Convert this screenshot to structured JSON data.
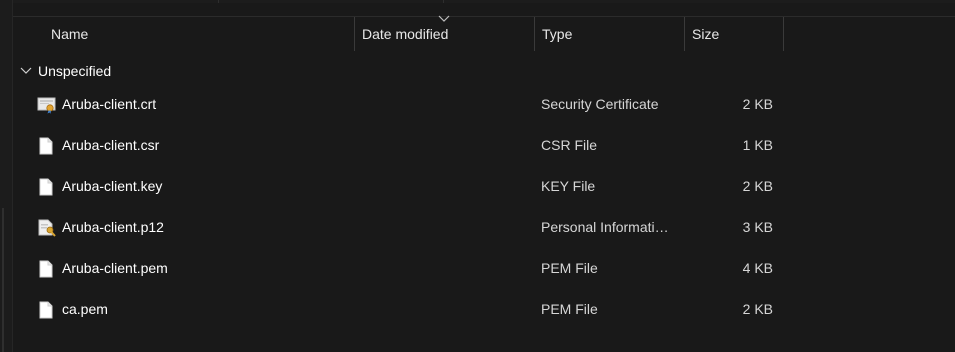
{
  "columns": {
    "name": "Name",
    "date_modified": "Date modified",
    "type": "Type",
    "size": "Size"
  },
  "sort": {
    "column": "date_modified",
    "icon": "chevron-down-icon"
  },
  "group": {
    "label": "Unspecified",
    "expanded": true,
    "icon": "chevron-down-icon"
  },
  "files": [
    {
      "name": "Aruba-client.crt",
      "type": "Security Certificate",
      "size": "2 KB",
      "icon": "certificate-icon"
    },
    {
      "name": "Aruba-client.csr",
      "type": "CSR File",
      "size": "1 KB",
      "icon": "file-icon"
    },
    {
      "name": "Aruba-client.key",
      "type": "KEY File",
      "size": "2 KB",
      "icon": "file-icon"
    },
    {
      "name": "Aruba-client.p12",
      "type": "Personal Informati…",
      "size": "3 KB",
      "icon": "personal-information-icon"
    },
    {
      "name": "Aruba-client.pem",
      "type": "PEM File",
      "size": "4 KB",
      "icon": "file-icon"
    },
    {
      "name": "ca.pem",
      "type": "PEM File",
      "size": "2 KB",
      "icon": "file-icon"
    }
  ],
  "colors": {
    "background": "#191919",
    "text": "#ffffff",
    "secondary_text": "#d6d6d6",
    "divider": "#3a3a3a"
  }
}
